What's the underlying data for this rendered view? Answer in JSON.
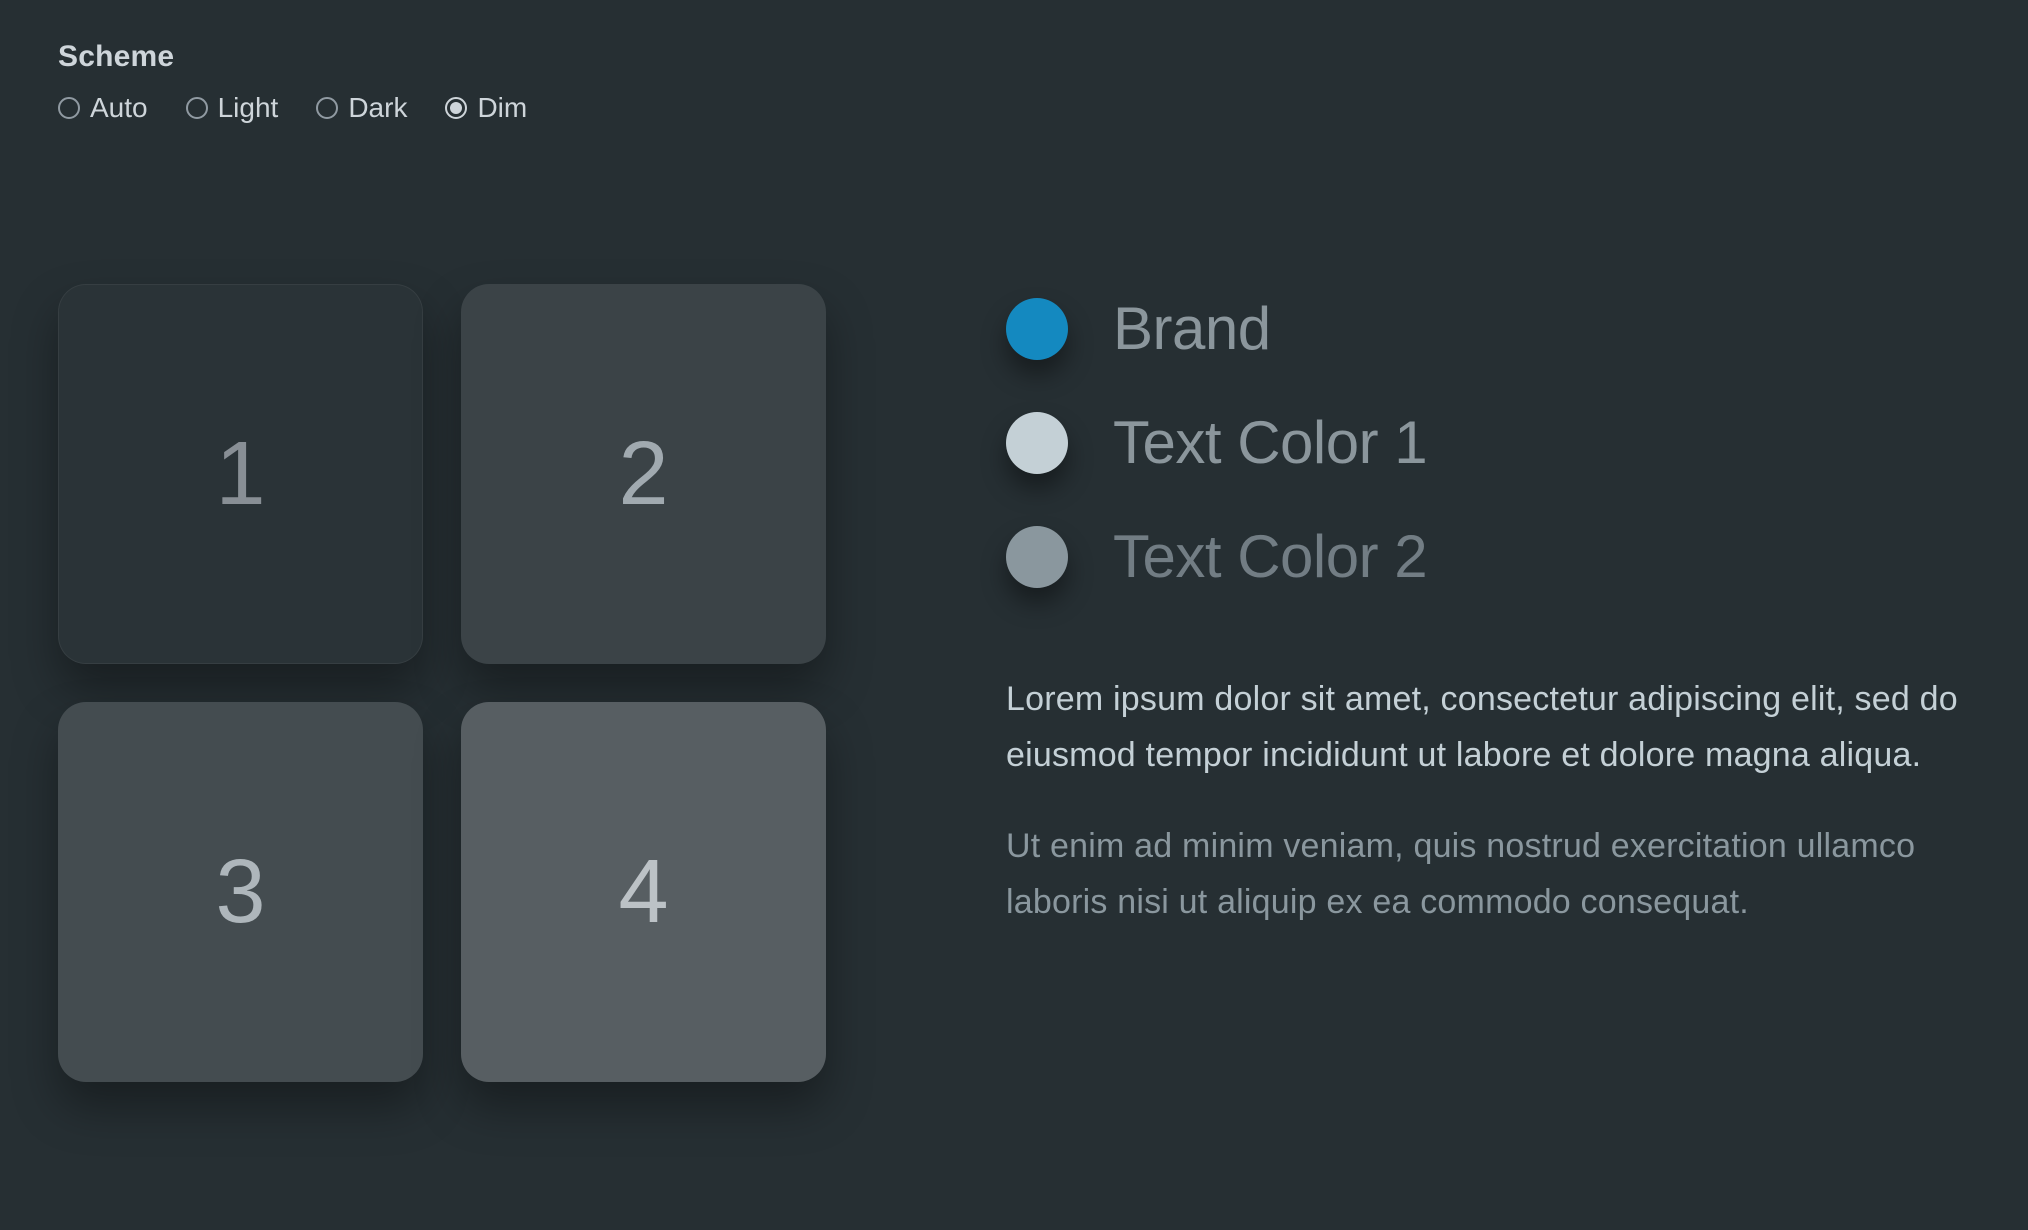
{
  "scheme": {
    "title": "Scheme",
    "options": [
      {
        "label": "Auto",
        "selected": false
      },
      {
        "label": "Light",
        "selected": false
      },
      {
        "label": "Dark",
        "selected": false
      },
      {
        "label": "Dim",
        "selected": true
      }
    ]
  },
  "swatches": [
    {
      "label": "1"
    },
    {
      "label": "2"
    },
    {
      "label": "3"
    },
    {
      "label": "4"
    }
  ],
  "colors": {
    "brand": {
      "label": "Brand",
      "hex": "#1489C0",
      "text_color": "#8B969C"
    },
    "text1": {
      "label": "Text Color 1",
      "hex": "#C4D0D6",
      "text_color": "#8B969C"
    },
    "text2": {
      "label": "Text Color 2",
      "hex": "#8A979E",
      "text_color": "#727D84"
    }
  },
  "paragraphs": {
    "p1": "Lorem ipsum dolor sit amet, consectetur adipiscing elit, sed do eiusmod tempor incididunt ut labore et dolore magna aliqua.",
    "p2": "Ut enim ad minim veniam, quis nostrud exercitation ullamco laboris nisi ut aliquip ex ea commodo consequat.",
    "p1_color": "#C4D0D6",
    "p2_color": "#8A979E"
  }
}
